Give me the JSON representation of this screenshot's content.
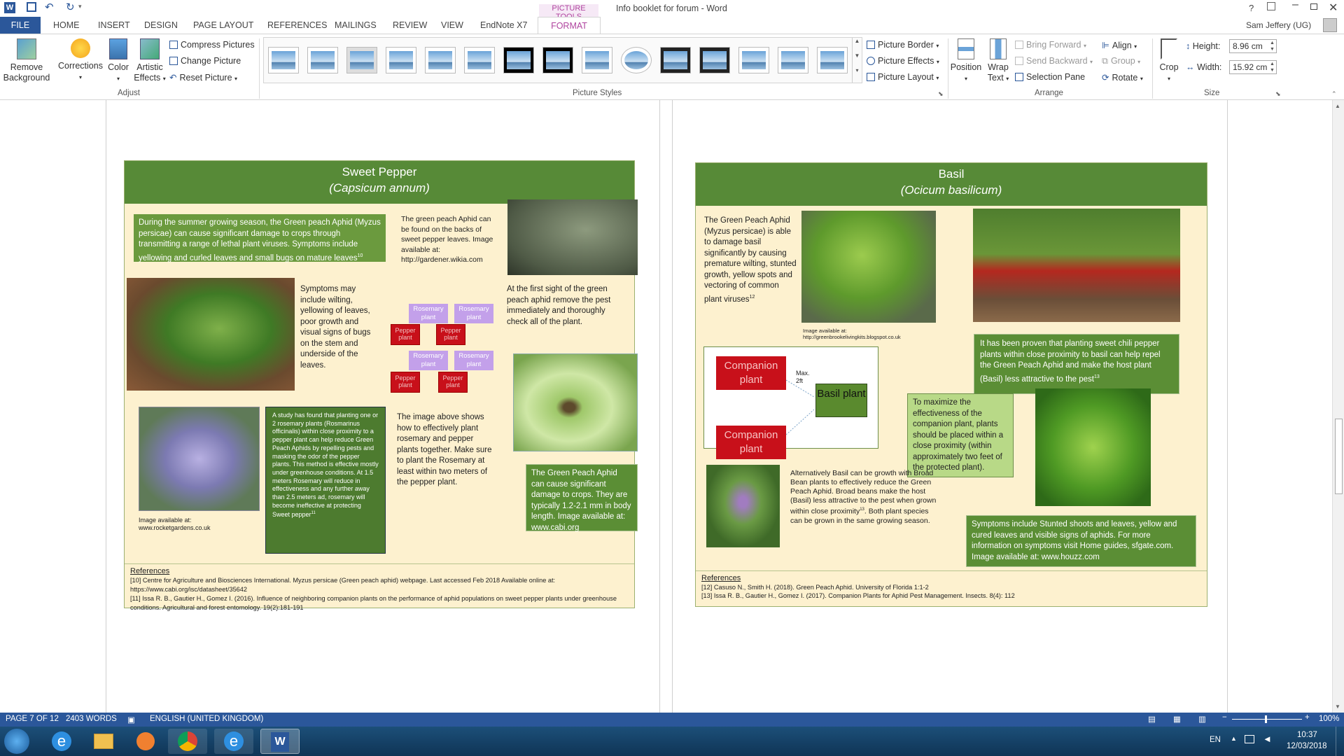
{
  "window": {
    "title": "Info booklet for forum - Word",
    "picture_tools": "PICTURE TOOLS",
    "user": "Sam Jeffery (UG)",
    "help": "?"
  },
  "tabs": [
    "FILE",
    "HOME",
    "INSERT",
    "DESIGN",
    "PAGE LAYOUT",
    "REFERENCES",
    "MAILINGS",
    "REVIEW",
    "VIEW",
    "EndNote X7",
    "FORMAT"
  ],
  "ribbon": {
    "remove_background": "Remove Background",
    "corrections": "Corrections",
    "color": "Color",
    "artistic_effects": "Artistic Effects",
    "compress": "Compress Pictures",
    "change": "Change Picture",
    "reset": "Reset Picture",
    "adjust_label": "Adjust",
    "styles_label": "Picture Styles",
    "picture_border": "Picture Border",
    "picture_effects": "Picture Effects",
    "picture_layout": "Picture Layout",
    "position": "Position",
    "wrap_text": "Wrap Text",
    "bring_forward": "Bring Forward",
    "send_backward": "Send Backward",
    "selection_pane": "Selection Pane",
    "align": "Align",
    "group": "Group",
    "rotate": "Rotate",
    "arrange_label": "Arrange",
    "crop": "Crop",
    "height_label": "Height:",
    "height_value": "8.96 cm",
    "width_label": "Width:",
    "width_value": "15.92 cm",
    "size_label": "Size"
  },
  "left_page": {
    "title": "Sweet Pepper",
    "subtitle": "(Capsicum annum)",
    "intro": "During the summer growing season, the Green peach Aphid (Myzus persicae) can cause significant damage to crops through transmitting a range of lethal plant viruses. Symptoms include yellowing and curled leaves and small bugs on mature leaves",
    "intro_sup": "10",
    "aphid_location": "The green peach Aphid can be found on the backs of sweet pepper leaves. Image available at: http://gardener.wikia.com",
    "symptoms": "Symptoms may include wilting, yellowing of leaves, poor growth and visual signs of bugs on the stem and underside of the leaves.",
    "first_sight": "At the first sight of the green peach aphid remove the pest immediately and thoroughly check all of the plant.",
    "rosemary": "Rosemary plant",
    "pepper": "Pepper plant",
    "study": "A study has found that planting one or 2 rosemary plants (Rosmarinus officinalis) within close proximity to a pepper plant can help reduce Green Peach Aphids by repelling pests and masking the odor of the pepper plants. This method is effective mostly under greenhouse conditions. At 1.5 meters Rosemary will reduce in effectiveness and any further away than 2.5 meters ad, rosemary will become ineffective at protecting Sweet pepper",
    "study_sup": "11",
    "image_above": "The image above shows how to effectively plant rosemary and pepper plants together. Make sure to plant the Rosemary at least within two meters of the pepper plant.",
    "rosemary_credit": "Image available at: www.rocketgardens.co.uk",
    "cabi_box": "The Green Peach Aphid can cause significant damage to crops. They are typically 1.2-2.1 mm in body length. Image available at: www.cabi.org",
    "references_title": "References",
    "ref10": "[10] Centre for Agriculture and Biosciences International. Myzus persicae (Green peach aphid) webpage. Last accessed Feb 2018 Available online at: https://www.cabi.org/isc/datasheet/35642",
    "ref11": "[11] Issa R. B., Gautier H., Gomez I. (2016). Influence of neighboring companion plants on the performance of aphid populations on sweet pepper plants under greenhouse conditions. Agricultural and forest entomology. 19(2):181-191"
  },
  "right_page": {
    "title": "Basil",
    "subtitle": "(Ocicum basilicum)",
    "intro": "The Green Peach Aphid (Myzus persicae) is able to damage basil significantly by causing premature wilting, stunted growth, yellow spots and vectoring of common plant viruses",
    "intro_sup": "12",
    "basil_credit": "Image available at: http://greenbrookelivingkits.blogspot.co.uk",
    "chili": "It has been proven that planting sweet chili pepper plants within close proximity to basil can help repel the Green Peach Aphid and make the host plant (Basil) less attractive to the pest",
    "chili_sup": "13",
    "companion": "Companion plant",
    "basil_plant": "Basil plant",
    "max": "Max. 2ft",
    "maximize": "To maximize the effectiveness of the companion plant, plants should be placed within a close proximity (within approximately two feet of the protected plant).",
    "broad_bean": "Alternatively Basil can be growth with Broad Bean plants to effectively reduce the Green Peach Aphid. Broad beans make the host (Basil) less attractive to the pest when grown within close proximity",
    "broad_bean_sup": "13",
    "broad_bean_2": ". Both plant species can be grown in the same growing season.",
    "symptoms": "Symptoms include Stunted shoots and leaves, yellow and cured leaves and visible signs of aphids. For more information on symptoms visit Home guides, sfgate.com. Image available at: www.houzz.com",
    "references_title": "References",
    "ref12": "[12] Casuso N., Smith H. (2018). Green Peach Aphid. University of Florida 1:1-2",
    "ref13": "[13] Issa R. B., Gautier H., Gomez I. (2017). Companion Plants for Aphid Pest Management. Insects. 8(4): 112"
  },
  "status": {
    "page": "PAGE 7 OF 12",
    "words": "2403 WORDS",
    "language": "ENGLISH (UNITED KINGDOM)",
    "zoom": "100%"
  },
  "taskbar": {
    "lang": "EN",
    "time": "10:37",
    "date": "12/03/2018"
  }
}
